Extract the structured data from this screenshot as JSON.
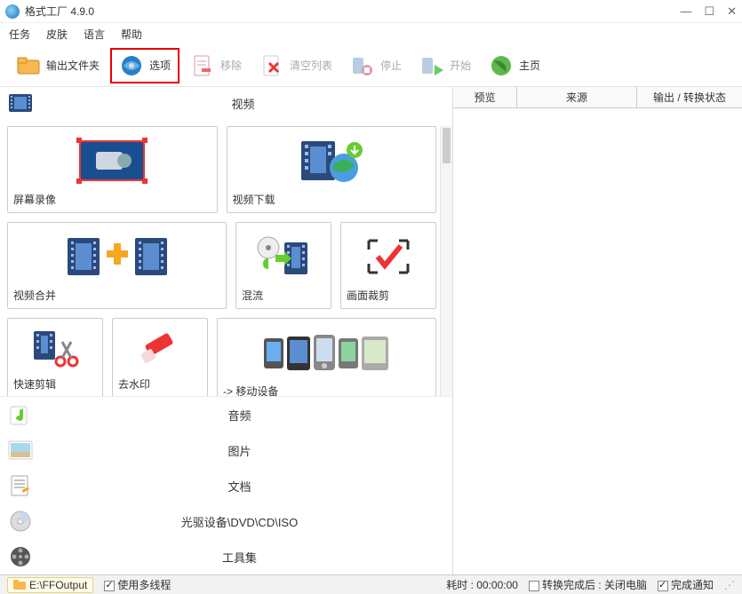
{
  "title": "格式工厂 4.9.0",
  "menus": [
    "任务",
    "皮肤",
    "语言",
    "帮助"
  ],
  "toolbar": {
    "output_folder": "输出文件夹",
    "options": "选项",
    "remove": "移除",
    "clear_list": "清空列表",
    "stop": "停止",
    "start": "开始",
    "home": "主页"
  },
  "categories": {
    "video": "视频",
    "audio": "音频",
    "image": "图片",
    "document": "文档",
    "disc": "光驱设备\\DVD\\CD\\ISO",
    "tools": "工具集"
  },
  "video_cards": {
    "screen_record": "屏幕录像",
    "video_download": "视频下载",
    "video_merge": "视频合并",
    "mix": "混流",
    "crop": "画面裁剪",
    "quick_cut": "快速剪辑",
    "watermark": "去水印",
    "mobile": "-> 移动设备"
  },
  "right_headers": {
    "preview": "预览",
    "source": "来源",
    "output": "输出 / 转换状态"
  },
  "statusbar": {
    "output_path": "E:\\FFOutput",
    "multithread": "使用多线程",
    "elapsed": "耗时 : 00:00:00",
    "shutdown_after": "转换完成后 : 关闭电脑",
    "finish_notify": "完成通知"
  }
}
